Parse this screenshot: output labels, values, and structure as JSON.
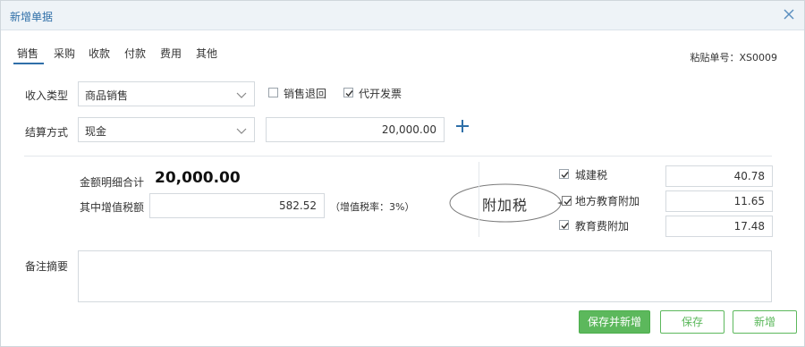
{
  "dialog": {
    "title": "新增单据",
    "close_icon": "close-icon"
  },
  "tabs": [
    {
      "label": "销售",
      "active": true
    },
    {
      "label": "采购",
      "active": false
    },
    {
      "label": "收款",
      "active": false
    },
    {
      "label": "付款",
      "active": false
    },
    {
      "label": "费用",
      "active": false
    },
    {
      "label": "其他",
      "active": false
    }
  ],
  "paste_number": "粘贴单号：XS0009",
  "income_type": {
    "label": "收入类型",
    "value": "商品销售",
    "options": {
      "sales_return": {
        "label": "销售退回",
        "checked": false
      },
      "invoice_agent": {
        "label": "代开发票",
        "checked": true
      }
    }
  },
  "settlement": {
    "label": "结算方式",
    "value": "现金",
    "amount": "20,000.00",
    "add_icon": "plus-icon"
  },
  "summary": {
    "total_label": "金额明细合计",
    "total_value": "20,000.00",
    "vat_label": "其中增值税额",
    "vat_value": "582.52",
    "vat_rate_text": "（增值税率：3%）"
  },
  "annotation": {
    "text": "附加税"
  },
  "surtaxes": [
    {
      "label": "城建税",
      "checked": true,
      "value": "40.78"
    },
    {
      "label": "地方教育附加",
      "checked": true,
      "value": "11.65"
    },
    {
      "label": "教育费附加",
      "checked": true,
      "value": "17.48"
    }
  ],
  "memo": {
    "label": "备注摘要",
    "value": ""
  },
  "buttons": {
    "save_and_new": "保存并新增",
    "save": "保存",
    "new": "新增"
  },
  "colors": {
    "accent": "#2f6fa8",
    "primary_button": "#5cb85c"
  }
}
